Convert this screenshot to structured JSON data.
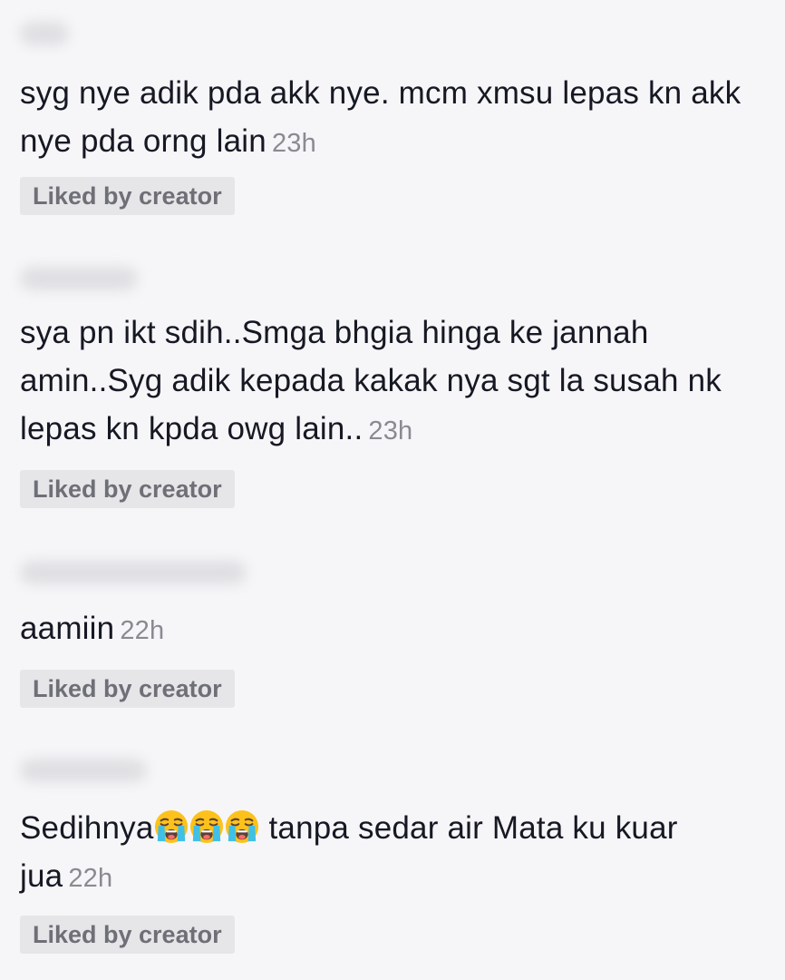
{
  "comments": [
    {
      "username": "",
      "text": "syg nye adik pda akk nye. mcm xmsu lepas kn akk nye pda orng lain",
      "time": "23h",
      "badge": "Liked by creator"
    },
    {
      "username": "",
      "text": "sya pn ikt sdih..Smga bhgia hinga ke jannah amin..Syg adik kepada kakak nya sgt la susah nk lepas kn kpda owg lain..",
      "time": "23h",
      "badge": "Liked by creator"
    },
    {
      "username": "",
      "text": "aamiin",
      "time": "22h",
      "badge": "Liked by creator"
    },
    {
      "username": "",
      "text_before": "Sedihnya",
      "emojis": [
        "loudly-crying-face-icon",
        "loudly-crying-face-icon",
        "loudly-crying-face-icon"
      ],
      "text_after": " tanpa sedar air Mata ku kuar jua",
      "time": "22h",
      "badge": "Liked by creator"
    }
  ],
  "colors": {
    "background": "#f6f6f8",
    "text": "#161823",
    "time": "#8a8b91",
    "badge_bg": "#e6e6e9",
    "badge_text": "#6f7077"
  }
}
